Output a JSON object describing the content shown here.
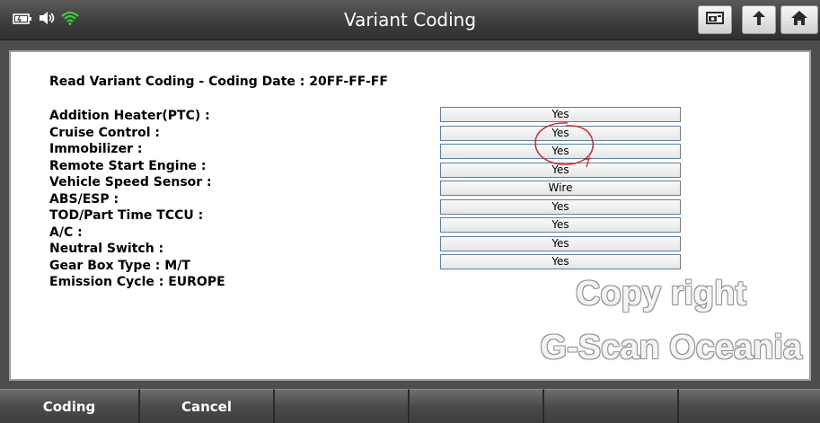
{
  "header": {
    "title": "Variant Coding"
  },
  "status_icons": [
    "battery-icon",
    "speaker-icon",
    "wifi-icon"
  ],
  "toolbar_icons": [
    "screenshot-icon",
    "back-icon",
    "home-icon"
  ],
  "coding": {
    "heading": "Read Variant Coding -  Coding Date : 20FF-FF-FF",
    "items": [
      {
        "label": "Addition Heater(PTC) :",
        "value": "Yes"
      },
      {
        "label": "Cruise Control :",
        "value": "Yes"
      },
      {
        "label": "Immobilizer :",
        "value": "Yes"
      },
      {
        "label": "Remote Start Engine :",
        "value": "Yes"
      },
      {
        "label": "Vehicle Speed Sensor :",
        "value": "Wire"
      },
      {
        "label": "ABS/ESP :",
        "value": "Yes"
      },
      {
        "label": "TOD/Part Time TCCU :",
        "value": "Yes"
      },
      {
        "label": "A/C :",
        "value": "Yes"
      },
      {
        "label": "Neutral Switch :",
        "value": "Yes"
      }
    ],
    "static_items": [
      "Gear Box Type : M/T",
      "Emission Cycle : EUROPE"
    ]
  },
  "watermark": {
    "line1": "Copy right",
    "line2": "G-Scan Oceania"
  },
  "footer": {
    "buttons": [
      "Coding",
      "Cancel",
      "",
      "",
      "",
      ""
    ]
  },
  "colors": {
    "annotation": "#d62020",
    "box_border": "#5d7fa3"
  }
}
